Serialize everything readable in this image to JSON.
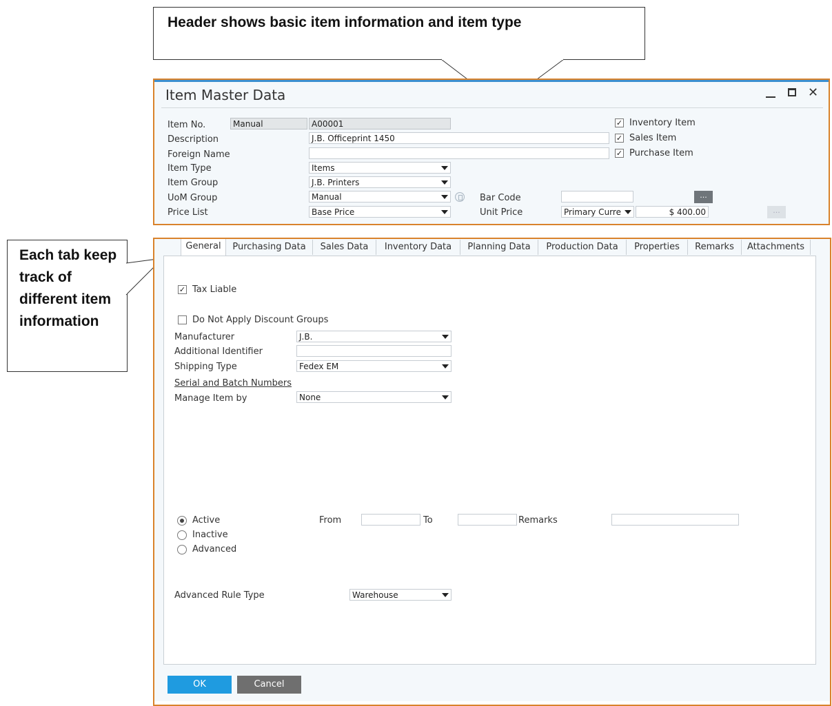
{
  "callouts": {
    "header_note": "Header shows basic item information and item type",
    "tab_note": "Each tab keep track of different item information"
  },
  "window": {
    "title": "Item Master Data",
    "minimize": "_",
    "maximize": "□",
    "close": "✕"
  },
  "header": {
    "item_no_label": "Item No.",
    "numbering_value": "Manual",
    "item_no_value": "A00001",
    "description_label": "Description",
    "description_value": "J.B. Officeprint 1450",
    "foreign_name_label": "Foreign Name",
    "foreign_name_value": "",
    "item_type_label": "Item Type",
    "item_type_value": "Items",
    "item_group_label": "Item Group",
    "item_group_value": "J.B. Printers",
    "uom_group_label": "UoM Group",
    "uom_group_value": "Manual",
    "price_list_label": "Price List",
    "price_list_value": "Base Price",
    "bar_code_label": "Bar Code",
    "bar_code_value": "",
    "unit_price_label": "Unit Price",
    "currency_value": "Primary Curre",
    "unit_price_value": "$ 400.00",
    "ellipsis": "...",
    "inventory_item_label": "Inventory Item",
    "inventory_item_checked": true,
    "sales_item_label": "Sales Item",
    "sales_item_checked": true,
    "purchase_item_label": "Purchase Item",
    "purchase_item_checked": true,
    "check_mark": "✓"
  },
  "tabs": [
    {
      "label": "General",
      "active": true
    },
    {
      "label": "Purchasing Data",
      "active": false
    },
    {
      "label": "Sales Data",
      "active": false
    },
    {
      "label": "Inventory Data",
      "active": false
    },
    {
      "label": "Planning Data",
      "active": false
    },
    {
      "label": "Production Data",
      "active": false
    },
    {
      "label": "Properties",
      "active": false
    },
    {
      "label": "Remarks",
      "active": false
    },
    {
      "label": "Attachments",
      "active": false
    }
  ],
  "general": {
    "tax_liable_label": "Tax Liable",
    "tax_liable_checked": true,
    "no_discount_label": "Do Not Apply Discount Groups",
    "manufacturer_label": "Manufacturer",
    "manufacturer_value": "J.B.",
    "additional_id_label": "Additional Identifier",
    "additional_id_value": "",
    "shipping_type_label": "Shipping Type",
    "shipping_type_value": "Fedex EM",
    "serial_batch_link": "Serial and Batch Numbers",
    "manage_by_label": "Manage Item by",
    "manage_by_value": "None",
    "active_label": "Active",
    "inactive_label": "Inactive",
    "advanced_label": "Advanced",
    "from_label": "From",
    "to_label": "To",
    "remarks_label": "Remarks",
    "adv_rule_label": "Advanced Rule Type",
    "adv_rule_value": "Warehouse"
  },
  "buttons": {
    "ok": "OK",
    "cancel": "Cancel"
  },
  "colors": {
    "frame": "#d9822b",
    "ok_button": "#1f9be0",
    "cancel_button": "#6f6f6f",
    "title_accent": "#3b8fd0"
  }
}
